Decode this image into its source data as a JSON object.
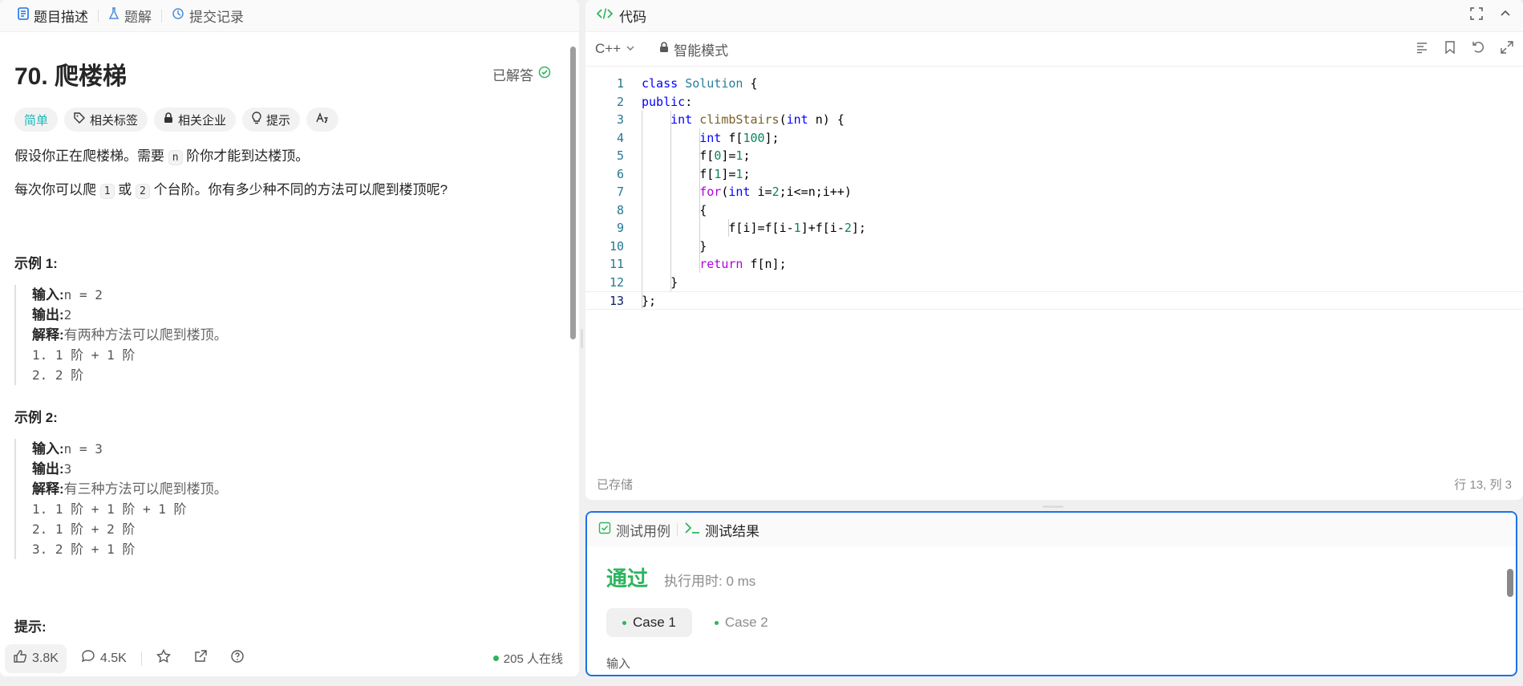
{
  "left": {
    "tabs": [
      {
        "label": "题目描述",
        "icon": "document-icon"
      },
      {
        "label": "题解",
        "icon": "flask-icon"
      },
      {
        "label": "提交记录",
        "icon": "history-icon"
      }
    ],
    "problem": {
      "title": "70. 爬楼梯",
      "status": "已解答",
      "tags": {
        "difficulty": "简单",
        "topics": "相关标签",
        "companies": "相关企业",
        "hint": "提示"
      },
      "desc1_a": "假设你正在爬楼梯。需要",
      "desc1_code": "n",
      "desc1_b": "阶你才能到达楼顶。",
      "desc2_a": "每次你可以爬",
      "desc2_code1": "1",
      "desc2_mid": "或",
      "desc2_code2": "2",
      "desc2_b": "个台阶。你有多少种不同的方法可以爬到楼顶呢?",
      "examples": [
        {
          "heading": "示例 1:",
          "input_label": "输入:",
          "input": "n = 2",
          "output_label": "输出:",
          "output": "2",
          "explain_label": "解释:",
          "explain": "有两种方法可以爬到楼顶。",
          "steps": [
            "1. 1 阶 + 1 阶",
            "2. 2 阶"
          ]
        },
        {
          "heading": "示例 2:",
          "input_label": "输入:",
          "input": "n = 3",
          "output_label": "输出:",
          "output": "3",
          "explain_label": "解释:",
          "explain": "有三种方法可以爬到楼顶。",
          "steps": [
            "1. 1 阶 + 1 阶 + 1 阶",
            "2. 1 阶 + 2 阶",
            "3. 2 阶 + 1 阶"
          ]
        }
      ],
      "hints_heading": "提示:"
    },
    "footer": {
      "likes": "3.8K",
      "comments": "4.5K",
      "online": "205 人在线"
    }
  },
  "code": {
    "title": "代码",
    "language": "C++",
    "mode": "智能模式",
    "saved": "已存储",
    "cursor": "行 13, 列 3",
    "lines": [
      "class Solution {",
      "public:",
      "    int climbStairs(int n) {",
      "        int f[100];",
      "        f[0]=1;",
      "        f[1]=1;",
      "        for(int i=2;i<=n;i++)",
      "        {",
      "            f[i]=f[i-1]+f[i-2];",
      "        }",
      "        return f[n];",
      "    }",
      "};"
    ]
  },
  "test": {
    "tab_cases": "测试用例",
    "tab_result": "测试结果",
    "status": "通过",
    "runtime": "执行用时: 0 ms",
    "cases": [
      "Case 1",
      "Case 2"
    ],
    "input_label": "输入"
  },
  "colors": {
    "accent": "#1a73e8",
    "success": "#2db55d",
    "easy": "#1cb8b8"
  }
}
